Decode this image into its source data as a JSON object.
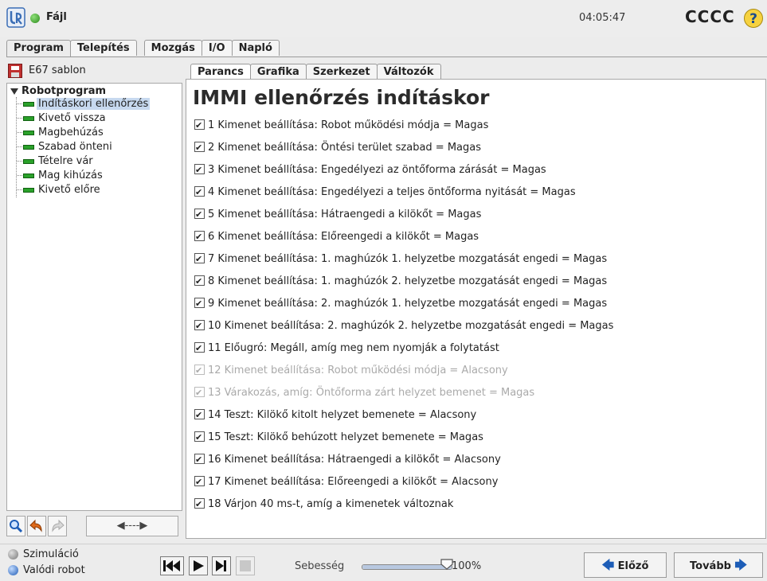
{
  "topbar": {
    "menu_label": "Fájl",
    "time": "04:05:47",
    "robot_name": "CCCC",
    "help_symbol": "?"
  },
  "main_tabs": [
    {
      "label": "Program",
      "active": true
    },
    {
      "label": "Telepítés"
    },
    {
      "label": "Mozgás"
    },
    {
      "label": "I/O"
    },
    {
      "label": "Napló"
    }
  ],
  "program": {
    "name": "E67 sablon"
  },
  "tree": {
    "root": "Robotprogram",
    "nodes": [
      {
        "label": "Indításkori ellenőrzés",
        "selected": true
      },
      {
        "label": "Kivető vissza"
      },
      {
        "label": "Magbehúzás"
      },
      {
        "label": "Szabad önteni"
      },
      {
        "label": "Tételre vár"
      },
      {
        "label": "Mag kihúzás"
      },
      {
        "label": "Kivető előre"
      }
    ],
    "tools": {
      "search_icon": "magnifier-icon",
      "undo_icon": "undo-icon",
      "redo_icon": "redo-icon",
      "move_label": "◀----▶"
    }
  },
  "sub_tabs": [
    {
      "label": "Parancs",
      "active": true
    },
    {
      "label": "Grafika"
    },
    {
      "label": "Szerkezet"
    },
    {
      "label": "Változók"
    }
  ],
  "command": {
    "title": "IMMI ellenőrzés indításkor",
    "lines": [
      {
        "text": "1 Kimenet beállítása: Robot működési módja = Magas",
        "enabled": true
      },
      {
        "text": "2 Kimenet beállítása: Öntési terület szabad = Magas",
        "enabled": true
      },
      {
        "text": "3 Kimenet beállítása: Engedélyezi az öntőforma zárását = Magas",
        "enabled": true
      },
      {
        "text": "4 Kimenet beállítása: Engedélyezi a teljes öntőforma nyitását = Magas",
        "enabled": true
      },
      {
        "text": "5 Kimenet beállítása: Hátraengedi a kilökőt = Magas",
        "enabled": true
      },
      {
        "text": "6 Kimenet beállítása: Előreengedi a kilökőt = Magas",
        "enabled": true
      },
      {
        "text": "7 Kimenet beállítása: 1. maghúzók 1. helyzetbe mozgatását engedi = Magas",
        "enabled": true
      },
      {
        "text": "8 Kimenet beállítása: 1. maghúzók 2. helyzetbe mozgatását engedi = Magas",
        "enabled": true
      },
      {
        "text": "9 Kimenet beállítása: 2. maghúzók 1. helyzetbe mozgatását engedi = Magas",
        "enabled": true
      },
      {
        "text": "10 Kimenet beállítása: 2. maghúzók 2. helyzetbe mozgatását engedi = Magas",
        "enabled": true
      },
      {
        "text": "11 Előugró: Megáll, amíg meg nem nyomják a folytatást",
        "enabled": true
      },
      {
        "text": "12 Kimenet beállítása: Robot működési módja = Alacsony",
        "enabled": false
      },
      {
        "text": "13 Várakozás, amíg: Öntőforma zárt helyzet bemenet = Magas",
        "enabled": false
      },
      {
        "text": "14 Teszt: Kilökő kitolt helyzet bemenete = Alacsony",
        "enabled": true
      },
      {
        "text": "15 Teszt: Kilökő behúzott helyzet bemenete = Magas",
        "enabled": true
      },
      {
        "text": "16 Kimenet beállítása: Hátraengedi a kilökőt = Alacsony",
        "enabled": true
      },
      {
        "text": "17 Kimenet beállítása: Előreengedi a kilökőt = Alacsony",
        "enabled": true
      },
      {
        "text": "18 Várjon 40 ms-t, amíg a kimenetek változnak",
        "enabled": true
      }
    ]
  },
  "bottom": {
    "modes": [
      {
        "label": "Szimuláció",
        "selected": false
      },
      {
        "label": "Valódi robot",
        "selected": true
      }
    ],
    "speed_label": "Sebesség",
    "speed_value_text": "100%",
    "speed_fraction": 1.0,
    "prev_label": "Előző",
    "next_label": "Tovább"
  },
  "colors": {
    "accent": "#1d5db7",
    "selection": "#c7d9ef",
    "node_icon": "#2aa12a"
  }
}
